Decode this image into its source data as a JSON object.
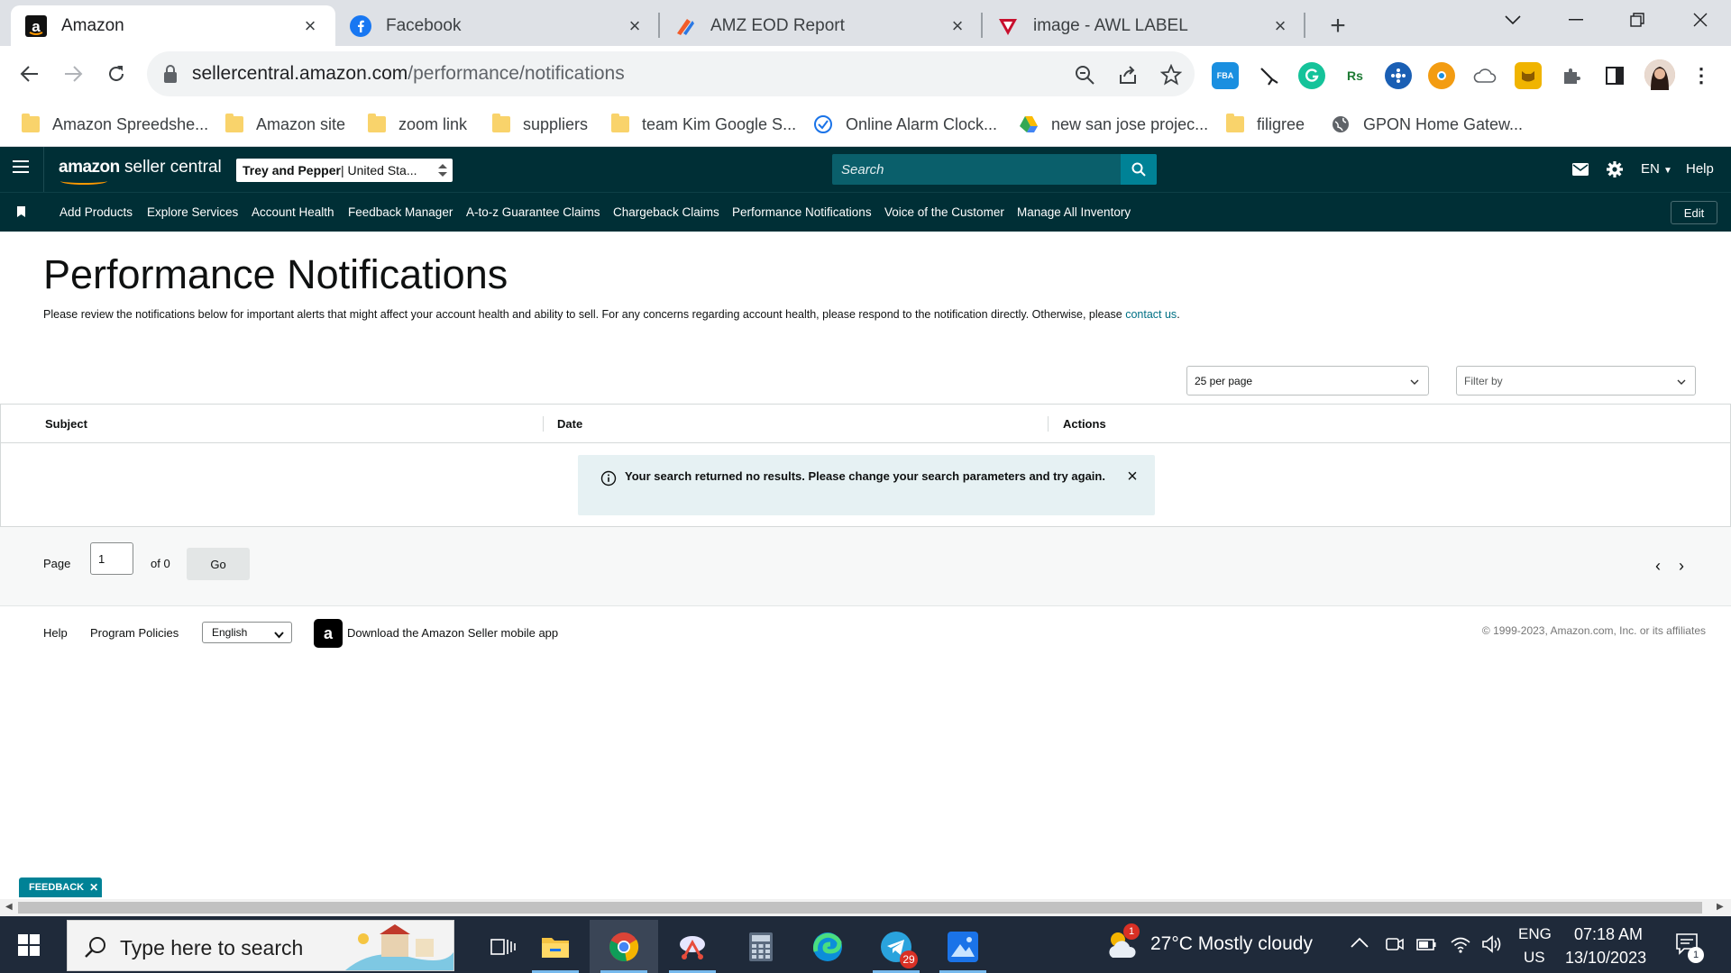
{
  "browser": {
    "tabs": [
      {
        "title": "Amazon",
        "active": true
      },
      {
        "title": "Facebook",
        "active": false
      },
      {
        "title": "AMZ EOD Report",
        "active": false
      },
      {
        "title": "image - AWL LABEL",
        "active": false
      }
    ],
    "url_domain": "sellercentral.amazon.com",
    "url_path": "/performance/notifications",
    "bookmarks": [
      "Amazon Spreedshe...",
      "Amazon site",
      "zoom link",
      "suppliers",
      "team Kim Google S...",
      "Online Alarm Clock...",
      "new san jose projec...",
      "filigree",
      "GPON Home Gatew..."
    ],
    "extensions": {
      "fba": "FBA",
      "rs": "Rs"
    }
  },
  "header": {
    "logo_brand": "amazon",
    "logo_suffix": " seller central",
    "store_name": "Trey and Pepper",
    "store_region": " | United Sta...",
    "search_placeholder": "Search",
    "language": "EN",
    "help": "Help"
  },
  "nav": {
    "items": [
      "Add Products",
      "Explore Services",
      "Account Health",
      "Feedback Manager",
      "A-to-z Guarantee Claims",
      "Chargeback Claims",
      "Performance Notifications",
      "Voice of the Customer",
      "Manage All Inventory"
    ],
    "edit": "Edit"
  },
  "page": {
    "title": "Performance Notifications",
    "description": "Please review the notifications below for important alerts that might affect your account health and ability to sell. For any concerns regarding account health, please respond to the notification directly. Otherwise, please ",
    "contact_link": "contact us",
    "description_end": ".",
    "per_page": "25 per page",
    "filter_placeholder": "Filter by"
  },
  "table": {
    "columns": [
      "Subject",
      "Date",
      "Actions"
    ],
    "empty_message": "Your search returned no results. Please change your search parameters and try again."
  },
  "pagination": {
    "page_label": "Page",
    "current_page": "1",
    "of_label": "of 0",
    "go": "Go"
  },
  "footer": {
    "help": "Help",
    "program_policies": "Program Policies",
    "language": "English",
    "app_link": "Download the Amazon Seller mobile app",
    "copyright": "© 1999-2023, Amazon.com, Inc. or its affiliates"
  },
  "feedback": "FEEDBACK",
  "taskbar": {
    "search_placeholder": "Type here to search",
    "telegram_badge": "29",
    "weather_badge": "1",
    "weather": "27°C  Mostly cloudy",
    "lang_top": "ENG",
    "lang_bottom": "US",
    "time": "07:18 AM",
    "date": "13/10/2023",
    "notification_count": "1"
  },
  "colors": {
    "header_bg": "#002f36",
    "search_bg": "#0a5f6b",
    "search_button": "#008296",
    "link": "#007185",
    "alert_bg": "#e6f1f3"
  }
}
